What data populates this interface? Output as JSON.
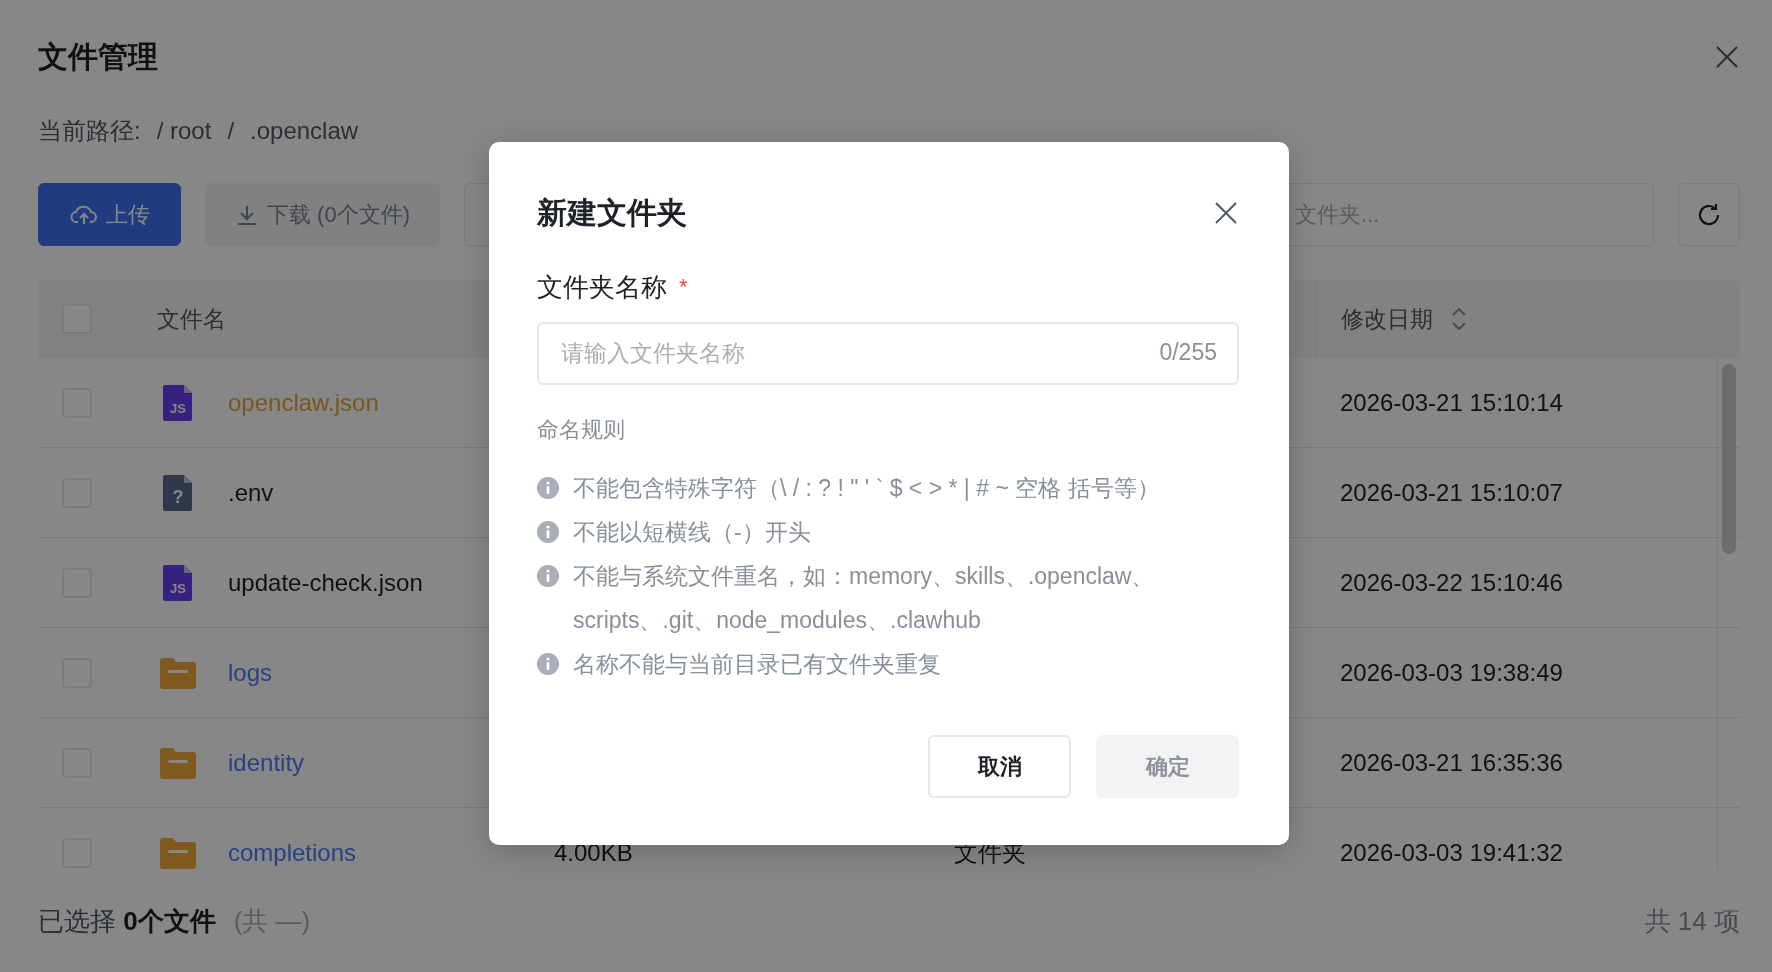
{
  "page": {
    "title": "文件管理",
    "path_label": "当前路径:",
    "breadcrumb": [
      "/ root",
      "/",
      ".openclaw"
    ]
  },
  "toolbar": {
    "upload_button": "上传",
    "download_button": {
      "label": "下载 (0个文件)",
      "disabled": true
    },
    "search": {
      "placeholder": "文件夹..."
    }
  },
  "table": {
    "select_all": {
      "checked": false
    },
    "columns": [
      {
        "label": "文件名",
        "sortable": false
      },
      {
        "label": "修改日期",
        "sortable": true
      }
    ],
    "rows": [
      {
        "name": "openclaw.json",
        "kind": "js",
        "icon_text": "JS",
        "highlighted": true,
        "modified": "2026-03-21 15:10:14",
        "checked": false
      },
      {
        "name": ".env",
        "kind": "unknown",
        "icon_text": "?",
        "highlighted": false,
        "modified": "2026-03-21 15:10:07",
        "checked": false
      },
      {
        "name": "update-check.json",
        "kind": "js",
        "icon_text": "JS",
        "highlighted": false,
        "modified": "2026-03-22 15:10:46",
        "checked": false
      },
      {
        "name": "logs",
        "kind": "folder",
        "highlighted": false,
        "modified": "2026-03-03 19:38:49",
        "checked": false
      },
      {
        "name": "identity",
        "kind": "folder",
        "highlighted": false,
        "modified": "2026-03-21 16:35:36",
        "checked": false
      },
      {
        "name": "completions",
        "kind": "folder",
        "highlighted": false,
        "size": "4.00KB",
        "type": "文件夹",
        "modified": "2026-03-03 19:41:32",
        "checked": false
      }
    ]
  },
  "footer": {
    "selected": "已选择 **0个文件**",
    "total_hint": "(共 —)",
    "count": "共 14 项"
  },
  "dialog": {
    "title": "新建文件夹",
    "field_label": "文件夹名称",
    "required_mark": "*",
    "input": {
      "placeholder": "请输入文件夹名称",
      "counter": "0/255"
    },
    "rules_title": "命名规则",
    "rules": [
      "不能包含特殊字符（\\ / : ? ! \" ' ` $ < > * | # ~ 空格 括号等）",
      "不能以短横线（-）开头",
      "不能与系统文件重名，如：memory、skills、.openclaw、scripts、.git、node_modules、.clawhub",
      "名称不能与当前目录已有文件夹重复"
    ],
    "cancel_button": "取消",
    "confirm_button": {
      "label": "确定",
      "disabled": true
    }
  }
}
